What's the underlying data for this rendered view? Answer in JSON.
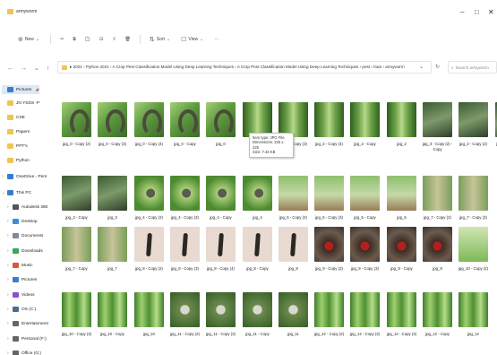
{
  "window": {
    "title": "armyworm",
    "controls": {
      "minimize": "–",
      "maximize": "□",
      "close": "✕"
    }
  },
  "toolbar": {
    "new_label": "New",
    "sort_label": "Sort",
    "view_label": "View",
    "more_label": "···"
  },
  "address": {
    "path": "▸ 2021 › Python 2021 › A Crop Pest Classification Model Using Deep Learning Techniques › A Crop Pest Classification Model Using Deep Learning Techniques › pest › train › armyworm",
    "search_placeholder": "Search armyworm"
  },
  "sidebar": {
    "items": [
      {
        "label": "Pictures",
        "icon": "pictures-icon",
        "color": "#3b7bd0",
        "pin": "📌",
        "indent": 0
      },
      {
        "label": "JN YSDS -P",
        "icon": "folder-icon",
        "color": "#f1c453",
        "indent": 0
      },
      {
        "label": "CSE",
        "icon": "folder-icon",
        "color": "#f1c453",
        "indent": 0
      },
      {
        "label": "Papers",
        "icon": "folder-icon",
        "color": "#f1c453",
        "indent": 0
      },
      {
        "label": "PPT's",
        "icon": "folder-icon",
        "color": "#f1c453",
        "indent": 0
      },
      {
        "label": "Python",
        "icon": "folder-icon",
        "color": "#f1c453",
        "indent": 0
      },
      {
        "label": "OneDrive - Pers",
        "icon": "cloud-icon",
        "color": "#2f7fd6",
        "indent": 0,
        "chev": "›"
      },
      {
        "label": "This PC",
        "icon": "pc-icon",
        "color": "#3b7bd0",
        "indent": 0,
        "chev": "⌄"
      },
      {
        "label": "Autodesk 360",
        "icon": "autodesk-icon",
        "color": "#555555",
        "indent": 1,
        "chev": "›"
      },
      {
        "label": "Desktop",
        "icon": "desktop-icon",
        "color": "#3b8fd8",
        "indent": 1,
        "chev": "›"
      },
      {
        "label": "Documents",
        "icon": "documents-icon",
        "color": "#7d8a99",
        "indent": 1,
        "chev": "›"
      },
      {
        "label": "Downloads",
        "icon": "downloads-icon",
        "color": "#3aa65a",
        "indent": 1,
        "chev": "›"
      },
      {
        "label": "Music",
        "icon": "music-icon",
        "color": "#e0553a",
        "indent": 1,
        "chev": "›"
      },
      {
        "label": "Pictures",
        "icon": "pictures-icon",
        "color": "#3b7bd0",
        "indent": 1,
        "chev": "›"
      },
      {
        "label": "Videos",
        "icon": "videos-icon",
        "color": "#8c4fd0",
        "indent": 1,
        "chev": "›"
      },
      {
        "label": "OS (C:)",
        "icon": "drive-icon",
        "color": "#4d6c8c",
        "indent": 1,
        "chev": "›"
      },
      {
        "label": "Entertainment",
        "icon": "drive-icon",
        "color": "#666666",
        "indent": 1,
        "chev": "›"
      },
      {
        "label": "Personal (F:)",
        "icon": "drive-icon",
        "color": "#666666",
        "indent": 1,
        "chev": "›"
      },
      {
        "label": "Office (G:)",
        "icon": "drive-icon",
        "color": "#666666",
        "indent": 1,
        "chev": "›"
      }
    ]
  },
  "files": [
    [
      {
        "name": "jpg_0 - Copy (2)",
        "thumb": "cat"
      },
      {
        "name": "jpg_0 - Copy (3)",
        "thumb": "cat"
      },
      {
        "name": "jpg_0 - Copy (4)",
        "thumb": "cat"
      },
      {
        "name": "jpg_0 - Copy",
        "thumb": "cat"
      },
      {
        "name": "jpg_0",
        "thumb": "cat"
      },
      {
        "name": "",
        "thumb": "leaf"
      },
      {
        "name": "jpg_2 - Copy (3)",
        "thumb": "leaf"
      },
      {
        "name": "jpg_2 - Copy (4)",
        "thumb": "leaf"
      },
      {
        "name": "jpg_2 - Copy",
        "thumb": "leaf"
      },
      {
        "name": "jpg_2",
        "thumb": "leaf"
      },
      {
        "name": "jpg_3 - Copy (2) - Copy",
        "thumb": "worm"
      },
      {
        "name": "jpg_3 - Copy (2)",
        "thumb": "worm"
      },
      {
        "name": "jpg_3 - Copy (3)",
        "thumb": "worm"
      }
    ],
    [
      {
        "name": "jpg_3 - Copy",
        "thumb": "worm"
      },
      {
        "name": "jpg_3",
        "thumb": "worm"
      },
      {
        "name": "jpg_4 - Copy (2)",
        "thumb": "bug"
      },
      {
        "name": "jpg_4 - Copy (3)",
        "thumb": "bug"
      },
      {
        "name": "jpg_4 - Copy",
        "thumb": "bug"
      },
      {
        "name": "jpg_4",
        "thumb": "bug"
      },
      {
        "name": "jpg_5 - Copy (2)",
        "thumb": "pale"
      },
      {
        "name": "jpg_5 - Copy (3)",
        "thumb": "pale"
      },
      {
        "name": "jpg_5 - Copy",
        "thumb": "pale"
      },
      {
        "name": "jpg_5",
        "thumb": "pale"
      },
      {
        "name": "jpg_7 - Copy (2)",
        "thumb": "ear"
      },
      {
        "name": "jpg_7 - Copy (3)",
        "thumb": "ear"
      }
    ],
    [
      {
        "name": "jpg_7 - Copy",
        "thumb": "ear"
      },
      {
        "name": "jpg_7",
        "thumb": "ear"
      },
      {
        "name": "jpg_8 - Copy (2)",
        "thumb": "skin"
      },
      {
        "name": "jpg_8 - Copy (3)",
        "thumb": "skin"
      },
      {
        "name": "jpg_8 - Copy (4)",
        "thumb": "skin"
      },
      {
        "name": "jpg_8 - Copy",
        "thumb": "skin"
      },
      {
        "name": "jpg_8",
        "thumb": "skin"
      },
      {
        "name": "jpg_9 - Copy (2)",
        "thumb": "red"
      },
      {
        "name": "jpg_9 - Copy (3)",
        "thumb": "red"
      },
      {
        "name": "jpg_9 - Copy",
        "thumb": "red"
      },
      {
        "name": "jpg_9",
        "thumb": "red"
      },
      {
        "name": "jpg_10 - Copy (2)",
        "thumb": "field"
      }
    ],
    [
      {
        "name": "jpg_10 - Copy (3)",
        "thumb": "grass"
      },
      {
        "name": "jpg_10 - Copy",
        "thumb": "grass"
      },
      {
        "name": "jpg_10",
        "thumb": "grass"
      },
      {
        "name": "jpg_11 - Copy (2)",
        "thumb": "spider"
      },
      {
        "name": "jpg_11 - Copy (3)",
        "thumb": "spider"
      },
      {
        "name": "jpg_11 - Copy",
        "thumb": "spider"
      },
      {
        "name": "jpg_11",
        "thumb": "spider"
      },
      {
        "name": "jpg_12 - Copy (2)",
        "thumb": "grass"
      },
      {
        "name": "jpg_12 - Copy (3)",
        "thumb": "grass"
      },
      {
        "name": "jpg_12 - Copy (3)",
        "thumb": "grass"
      },
      {
        "name": "jpg_12 - Copy",
        "thumb": "grass"
      },
      {
        "name": "jpg_12",
        "thumb": "grass"
      }
    ]
  ],
  "tooltip": {
    "line1": "Item type: JPG File",
    "line2": "Dimensions: 225 x 225",
    "line3": "Size: 7.33 KB"
  },
  "colors": {
    "accent": "#0067c0",
    "selection": "#dce9f7",
    "folder": "#f1c453"
  }
}
